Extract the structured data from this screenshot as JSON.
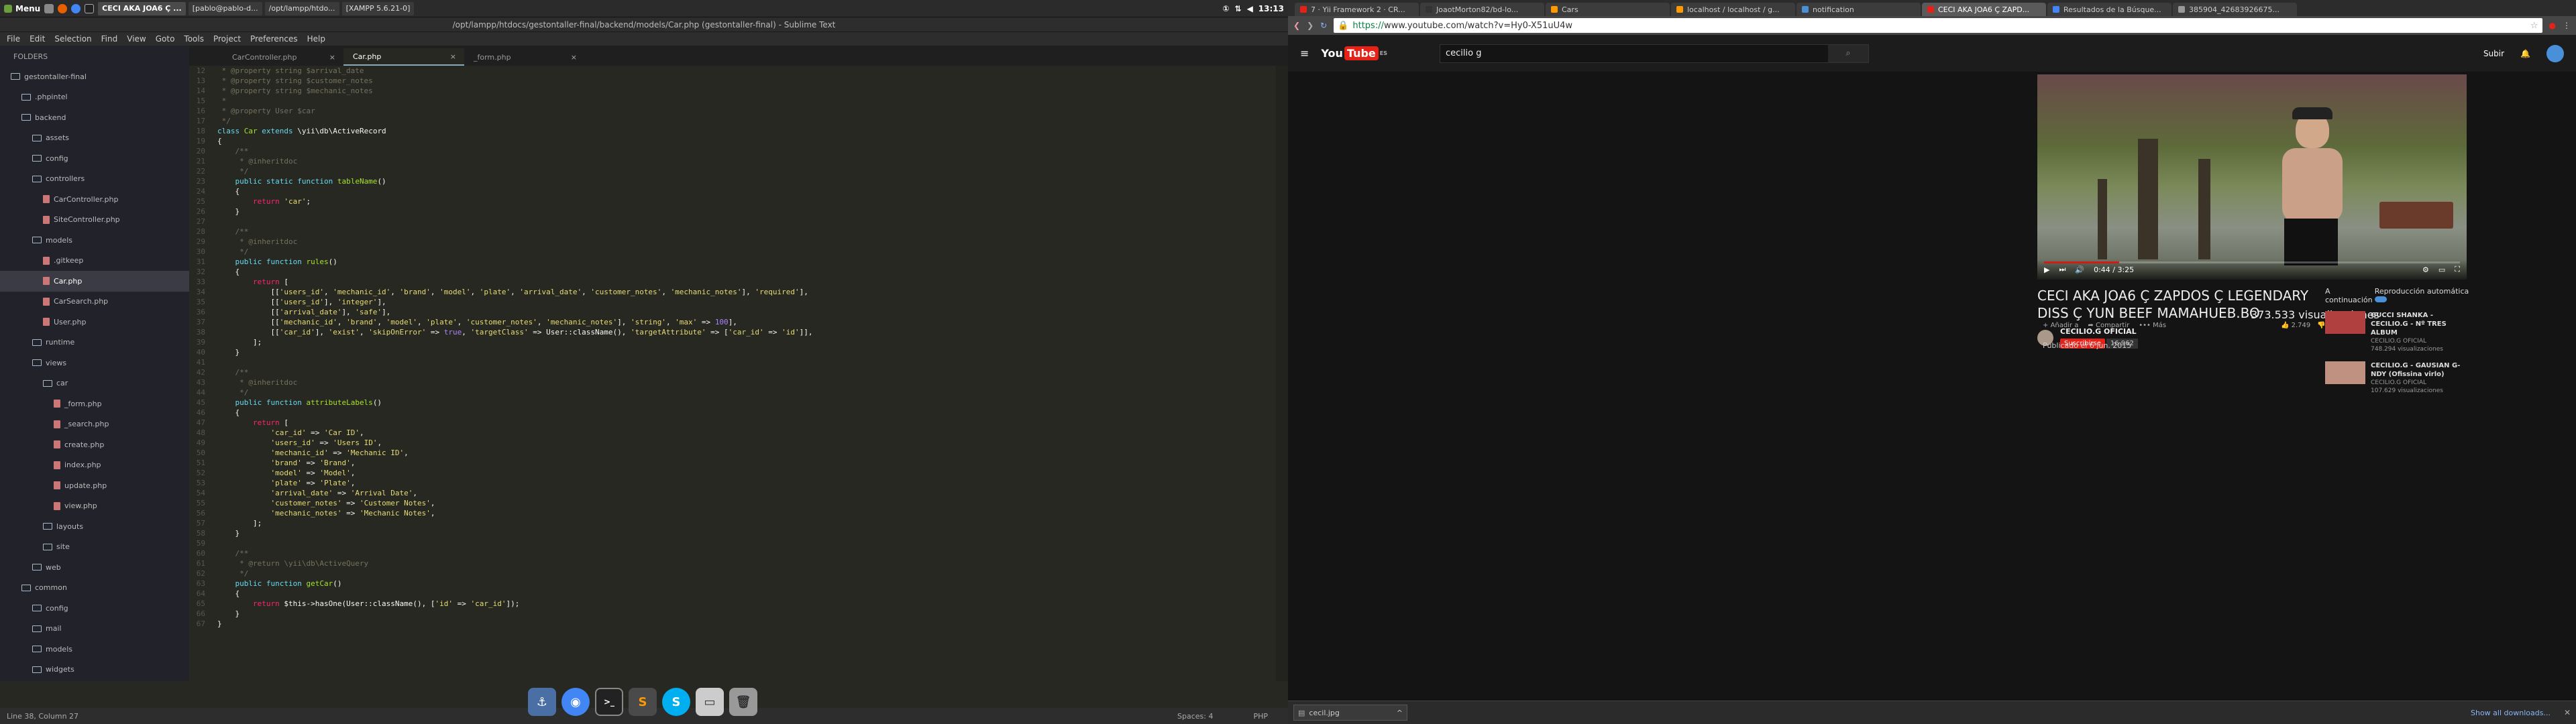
{
  "topbar": {
    "menu_label": "Menu",
    "windows": [
      {
        "label": "CECI AKA JOA6 Ç ...",
        "active": true
      },
      {
        "label": "[pablo@pablo-d..."
      },
      {
        "label": "/opt/lampp/htdo..."
      },
      {
        "label": "[XAMPP 5.6.21-0]"
      }
    ],
    "clock": "13:13"
  },
  "sublime": {
    "title": "/opt/lampp/htdocs/gestontaller-final/backend/models/Car.php (gestontaller-final) - Sublime Text",
    "menu": [
      "File",
      "Edit",
      "Selection",
      "Find",
      "View",
      "Goto",
      "Tools",
      "Project",
      "Preferences",
      "Help"
    ],
    "sidebar_header": "FOLDERS",
    "tree": [
      {
        "label": "gestontaller-final",
        "type": "folder",
        "depth": 0
      },
      {
        "label": ".phpintel",
        "type": "folder",
        "depth": 1
      },
      {
        "label": "backend",
        "type": "folder",
        "depth": 1
      },
      {
        "label": "assets",
        "type": "folder",
        "depth": 2
      },
      {
        "label": "config",
        "type": "folder",
        "depth": 2
      },
      {
        "label": "controllers",
        "type": "folder",
        "depth": 2
      },
      {
        "label": "CarController.php",
        "type": "file",
        "depth": 3
      },
      {
        "label": "SiteController.php",
        "type": "file",
        "depth": 3
      },
      {
        "label": "models",
        "type": "folder",
        "depth": 2
      },
      {
        "label": ".gitkeep",
        "type": "file",
        "depth": 3
      },
      {
        "label": "Car.php",
        "type": "file",
        "depth": 3,
        "selected": true
      },
      {
        "label": "CarSearch.php",
        "type": "file",
        "depth": 3
      },
      {
        "label": "User.php",
        "type": "file",
        "depth": 3
      },
      {
        "label": "runtime",
        "type": "folder",
        "depth": 2
      },
      {
        "label": "views",
        "type": "folder",
        "depth": 2
      },
      {
        "label": "car",
        "type": "folder",
        "depth": 3
      },
      {
        "label": "_form.php",
        "type": "file",
        "depth": 4
      },
      {
        "label": "_search.php",
        "type": "file",
        "depth": 4
      },
      {
        "label": "create.php",
        "type": "file",
        "depth": 4
      },
      {
        "label": "index.php",
        "type": "file",
        "depth": 4
      },
      {
        "label": "update.php",
        "type": "file",
        "depth": 4
      },
      {
        "label": "view.php",
        "type": "file",
        "depth": 4
      },
      {
        "label": "layouts",
        "type": "folder",
        "depth": 3
      },
      {
        "label": "site",
        "type": "folder",
        "depth": 3
      },
      {
        "label": "web",
        "type": "folder",
        "depth": 2
      },
      {
        "label": "common",
        "type": "folder",
        "depth": 1
      },
      {
        "label": "config",
        "type": "folder",
        "depth": 2
      },
      {
        "label": "mail",
        "type": "folder",
        "depth": 2
      },
      {
        "label": "models",
        "type": "folder",
        "depth": 2
      },
      {
        "label": "widgets",
        "type": "folder",
        "depth": 2
      },
      {
        "label": "console",
        "type": "folder",
        "depth": 1
      }
    ],
    "tabs": [
      {
        "label": "CarController.php"
      },
      {
        "label": "Car.php",
        "active": true
      },
      {
        "label": "_form.php"
      }
    ],
    "code_lines": [
      {
        "n": "12",
        "html": "<span class='cm'> * @property string $arrival_date</span>"
      },
      {
        "n": "13",
        "html": "<span class='cm'> * @property string $customer_notes</span>"
      },
      {
        "n": "14",
        "html": "<span class='cm'> * @property string $mechanic_notes</span>"
      },
      {
        "n": "15",
        "html": "<span class='cm'> *</span>"
      },
      {
        "n": "16",
        "html": "<span class='cm'> * @property User $car</span>"
      },
      {
        "n": "17",
        "html": "<span class='cm'> */</span>"
      },
      {
        "n": "18",
        "html": "<span class='kw'>class</span> <span class='fn'>Car</span> <span class='kw'>extends</span> \\yii\\db\\ActiveRecord"
      },
      {
        "n": "19",
        "html": "{"
      },
      {
        "n": "20",
        "html": "    <span class='cm'>/**</span>"
      },
      {
        "n": "21",
        "html": "    <span class='cm'> * @inheritdoc</span>"
      },
      {
        "n": "22",
        "html": "    <span class='cm'> */</span>"
      },
      {
        "n": "23",
        "html": "    <span class='kw'>public static function</span> <span class='fn'>tableName</span>()"
      },
      {
        "n": "24",
        "html": "    {"
      },
      {
        "n": "25",
        "html": "        <span class='kw2'>return</span> <span class='st'>'car'</span>;"
      },
      {
        "n": "26",
        "html": "    }"
      },
      {
        "n": "27",
        "html": ""
      },
      {
        "n": "28",
        "html": "    <span class='cm'>/**</span>"
      },
      {
        "n": "29",
        "html": "    <span class='cm'> * @inheritdoc</span>"
      },
      {
        "n": "30",
        "html": "    <span class='cm'> */</span>"
      },
      {
        "n": "31",
        "html": "    <span class='kw'>public function</span> <span class='fn'>rules</span>()"
      },
      {
        "n": "32",
        "html": "    {"
      },
      {
        "n": "33",
        "html": "        <span class='kw2'>return</span> ["
      },
      {
        "n": "34",
        "html": "            [[<span class='st'>'users_id'</span>, <span class='st'>'mechanic_id'</span>, <span class='st'>'brand'</span>, <span class='st'>'model'</span>, <span class='st'>'plate'</span>, <span class='st'>'arrival_date'</span>, <span class='st'>'customer_notes'</span>, <span class='st'>'mechanic_notes'</span>], <span class='st'>'required'</span>],"
      },
      {
        "n": "35",
        "html": "            [[<span class='st'>'users_id'</span>], <span class='st'>'integer'</span>],"
      },
      {
        "n": "36",
        "html": "            [[<span class='st'>'arrival_date'</span>], <span class='st'>'safe'</span>],"
      },
      {
        "n": "37",
        "html": "            [[<span class='st'>'mechanic_id'</span>, <span class='st'>'brand'</span>, <span class='st'>'model'</span>, <span class='st'>'plate'</span>, <span class='st'>'customer_notes'</span>, <span class='st'>'mechanic_notes'</span>], <span class='st'>'string'</span>, <span class='st'>'max'</span> =&gt; <span class='nm'>100</span>],"
      },
      {
        "n": "38",
        "html": "            [[<span class='st'>'car_id'</span>], <span class='st'>'exist'</span>, <span class='st'>'skipOnError'</span> =&gt; <span class='nm'>true</span>, <span class='st'>'targetClass'</span> =&gt; User::className(), <span class='st'>'targetAttribute'</span> =&gt; [<span class='st'>'car_id'</span> =&gt; <span class='st'>'id'</span>]],"
      },
      {
        "n": "39",
        "html": "        ];"
      },
      {
        "n": "40",
        "html": "    }"
      },
      {
        "n": "41",
        "html": ""
      },
      {
        "n": "42",
        "html": "    <span class='cm'>/**</span>"
      },
      {
        "n": "43",
        "html": "    <span class='cm'> * @inheritdoc</span>"
      },
      {
        "n": "44",
        "html": "    <span class='cm'> */</span>"
      },
      {
        "n": "45",
        "html": "    <span class='kw'>public function</span> <span class='fn'>attributeLabels</span>()"
      },
      {
        "n": "46",
        "html": "    {"
      },
      {
        "n": "47",
        "html": "        <span class='kw2'>return</span> ["
      },
      {
        "n": "48",
        "html": "            <span class='st'>'car_id'</span> =&gt; <span class='st'>'Car ID'</span>,"
      },
      {
        "n": "49",
        "html": "            <span class='st'>'users_id'</span> =&gt; <span class='st'>'Users ID'</span>,"
      },
      {
        "n": "50",
        "html": "            <span class='st'>'mechanic_id'</span> =&gt; <span class='st'>'Mechanic ID'</span>,"
      },
      {
        "n": "51",
        "html": "            <span class='st'>'brand'</span> =&gt; <span class='st'>'Brand'</span>,"
      },
      {
        "n": "52",
        "html": "            <span class='st'>'model'</span> =&gt; <span class='st'>'Model'</span>,"
      },
      {
        "n": "53",
        "html": "            <span class='st'>'plate'</span> =&gt; <span class='st'>'Plate'</span>,"
      },
      {
        "n": "54",
        "html": "            <span class='st'>'arrival_date'</span> =&gt; <span class='st'>'Arrival Date'</span>,"
      },
      {
        "n": "55",
        "html": "            <span class='st'>'customer_notes'</span> =&gt; <span class='st'>'Customer Notes'</span>,"
      },
      {
        "n": "56",
        "html": "            <span class='st'>'mechanic_notes'</span> =&gt; <span class='st'>'Mechanic Notes'</span>,"
      },
      {
        "n": "57",
        "html": "        ];"
      },
      {
        "n": "58",
        "html": "    }"
      },
      {
        "n": "59",
        "html": ""
      },
      {
        "n": "60",
        "html": "    <span class='cm'>/**</span>"
      },
      {
        "n": "61",
        "html": "    <span class='cm'> * @return \\yii\\db\\ActiveQuery</span>"
      },
      {
        "n": "62",
        "html": "    <span class='cm'> */</span>"
      },
      {
        "n": "63",
        "html": "    <span class='kw'>public function</span> <span class='fn'>getCar</span>()"
      },
      {
        "n": "64",
        "html": "    {"
      },
      {
        "n": "65",
        "html": "        <span class='kw2'>return</span> $this-&gt;hasOne(User::className(), [<span class='st'>'id'</span> =&gt; <span class='st'>'car_id'</span>]);"
      },
      {
        "n": "66",
        "html": "    }"
      },
      {
        "n": "67",
        "html": "}"
      }
    ],
    "status_left": "Line 38, Column 27",
    "status_spaces": "Spaces: 4",
    "status_syntax": "PHP"
  },
  "dock": [
    "anchor-icon",
    "chrome-icon",
    "terminal-icon",
    "sublime-icon",
    "skype-icon",
    "files-icon",
    "trash-icon"
  ],
  "chrome": {
    "tabs": [
      {
        "label": "7 · Yii Framework 2 · CR...",
        "color": "#e62117"
      },
      {
        "label": "JoaotMorton82/bd-lo...",
        "color": "#333"
      },
      {
        "label": "Cars",
        "color": "#f90"
      },
      {
        "label": "localhost / localhost / g...",
        "color": "#f90"
      },
      {
        "label": "notification",
        "color": "#4a90d9"
      },
      {
        "label": "CECI AKA JOA6 Ç ZAPD...",
        "color": "#e62117",
        "active": true
      },
      {
        "label": "Resultados de la Búsque...",
        "color": "#4285f4"
      },
      {
        "label": "385904_42683926675...",
        "color": "#999"
      }
    ],
    "url_scheme": "https://",
    "url_rest": "www.youtube.com/watch?v=Hy0-X51uU4w"
  },
  "youtube": {
    "logo_text": "You",
    "logo_tube": "Tube",
    "logo_region": "ES",
    "search_value": "cecilio g",
    "upload": "Subir",
    "time": "0:44 / 3:25",
    "title": "CECI AKA JOA6 Ç ZAPDOS Ç LEGENDARY DISS Ç YUN BEEF MAMAHUEB.BO",
    "channel": "CECILIO.G OFICIAL",
    "subscribe": "Suscribirse",
    "sub_count": "16.962",
    "views": "373.533 visualizaciones",
    "add_to": "Añadir a",
    "share": "Compartir",
    "more": "Más",
    "likes": "2.749",
    "dislikes": "807",
    "published": "Publicado el 6 jun. 2015",
    "up_next": "A continuación",
    "autoplay": "Reproducción automática",
    "related": [
      {
        "title": "GUCCI SHANKA - CECILIO.G - Nº TRES ALBUM",
        "channel": "CECILIO.G OFICIAL",
        "views": "748.294 visualizaciones"
      },
      {
        "title": "CECILIO.G - GAUSIAN G-NDY (Ofissina virlo)",
        "channel": "CECILIO.G OFICIAL",
        "views": "107.629 visualizaciones"
      }
    ]
  },
  "download_bar": {
    "file": "cecil.jpg",
    "show_all": "Show all downloads..."
  }
}
